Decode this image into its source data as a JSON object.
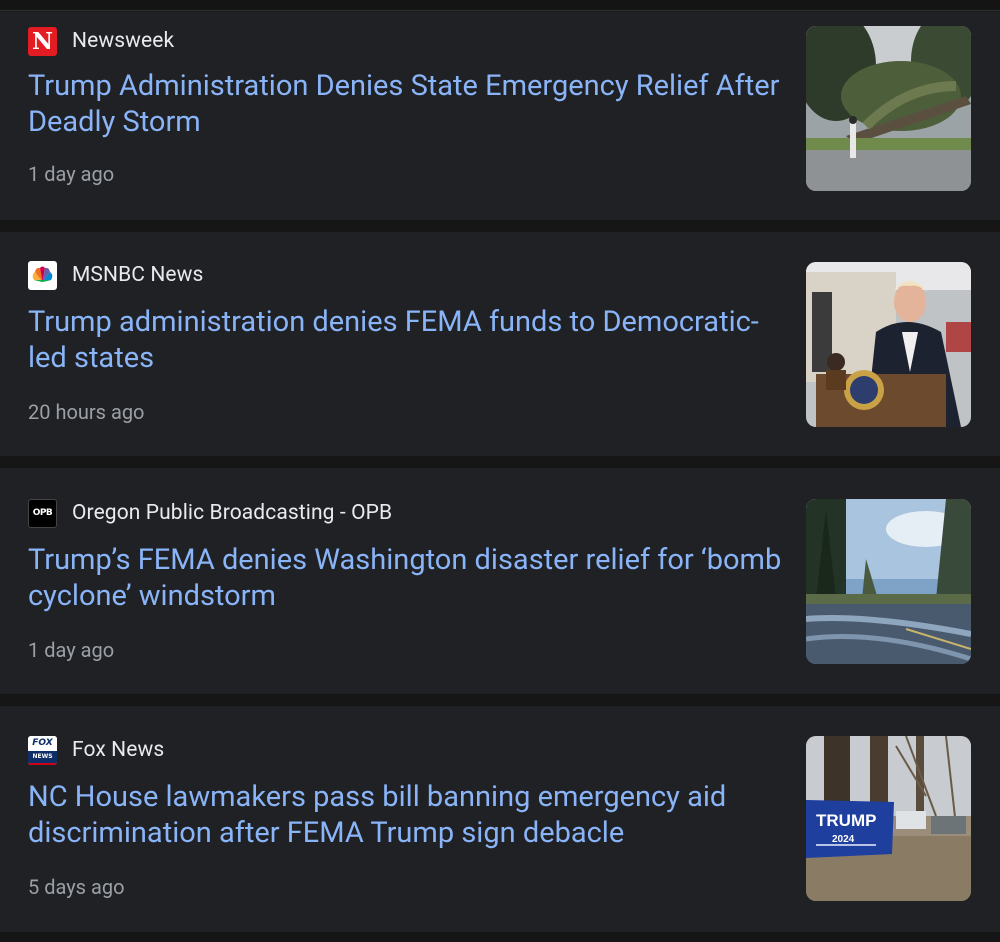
{
  "articles": [
    {
      "source": "Newsweek",
      "logo_icon": "newsweek-logo-icon",
      "logo_letter": "N",
      "logo_color": "#e31b23",
      "headline": "Trump Administration Denies State Emergency Relief After Deadly Storm",
      "time": "1 day ago",
      "thumbnail_icon": "fallen-tree-storm-photo"
    },
    {
      "source": "MSNBC News",
      "logo_icon": "msnbc-peacock-logo-icon",
      "headline": "Trump administration denies FEMA funds to Democratic-led states",
      "time": "20 hours ago",
      "thumbnail_icon": "president-podium-photo"
    },
    {
      "source": "Oregon Public Broadcasting - OPB",
      "logo_icon": "opb-logo-icon",
      "logo_letter": "OPB",
      "headline": "Trump’s FEMA denies Washington disaster relief for ‘bomb cyclone’ windstorm",
      "time": "1 day ago",
      "thumbnail_icon": "flooded-road-windstorm-photo"
    },
    {
      "source": "Fox News",
      "logo_icon": "fox-news-logo-icon",
      "logo_letter": "FOX NEWS",
      "headline": "NC House lawmakers pass bill banning emergency aid discrimination after FEMA Trump sign debacle",
      "time": "5 days ago",
      "thumbnail_icon": "trump-sign-trees-photo",
      "thumbnail_text": "TRUMP",
      "thumbnail_subtext": "2024"
    }
  ],
  "colors": {
    "background": "#1b1b1b",
    "card": "#202124",
    "headline": "#8ab4f8",
    "source": "#e8eaed",
    "time": "#9aa0a6"
  }
}
